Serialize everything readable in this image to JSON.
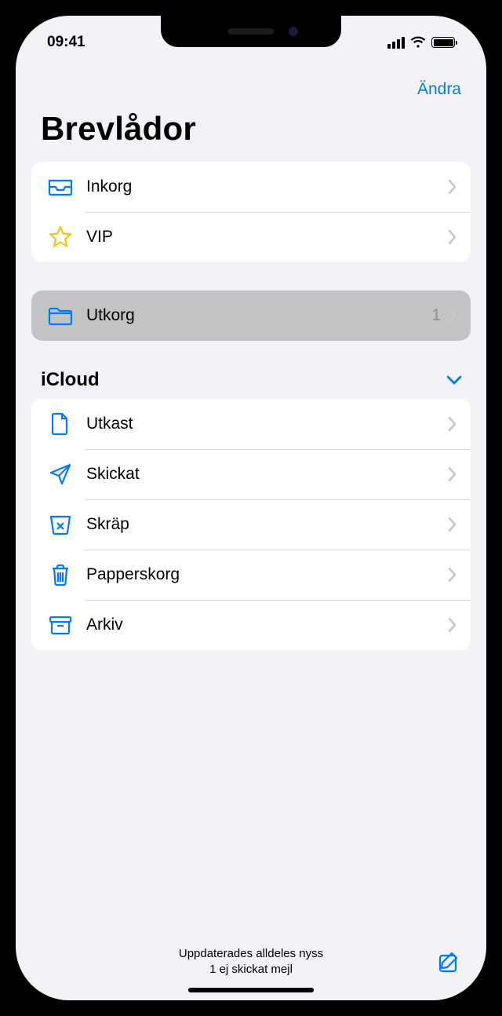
{
  "status_bar": {
    "time": "09:41"
  },
  "header": {
    "edit_label": "Ändra",
    "title": "Brevlådor"
  },
  "favorites": [
    {
      "icon": "inbox",
      "label": "Inkorg"
    },
    {
      "icon": "star",
      "label": "VIP"
    }
  ],
  "outbox": {
    "icon": "folder",
    "label": "Utkorg",
    "count": "1"
  },
  "account": {
    "name": "iCloud",
    "folders": [
      {
        "icon": "doc",
        "label": "Utkast"
      },
      {
        "icon": "paperplane",
        "label": "Skickat"
      },
      {
        "icon": "junk",
        "label": "Skräp"
      },
      {
        "icon": "trash",
        "label": "Papperskorg"
      },
      {
        "icon": "archive",
        "label": "Arkiv"
      }
    ]
  },
  "toolbar": {
    "status_line1": "Uppdaterades alldeles nyss",
    "status_line2": "1 ej skickat mejl"
  }
}
